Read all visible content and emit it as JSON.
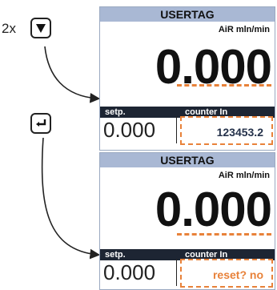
{
  "steps": {
    "step1_count": "2x",
    "step1_key_icon": "down-triangle-icon",
    "step2_key_icon": "enter-icon"
  },
  "panels": [
    {
      "title": "USERTAG",
      "unit": "AiR mln/min",
      "main_value": "0.000",
      "setp_label": "setp.",
      "setp_value": "0.000",
      "counter_label": "counter  In",
      "counter_value": "123453.2"
    },
    {
      "title": "USERTAG",
      "unit": "AiR mln/min",
      "main_value": "0.000",
      "setp_label": "setp.",
      "setp_value": "0.000",
      "counter_label": "counter  In",
      "counter_value": "reset? no"
    }
  ],
  "colors": {
    "title_bar": "#a9b8d4",
    "status_bar": "#1d2533",
    "highlight": "#e8823a"
  }
}
